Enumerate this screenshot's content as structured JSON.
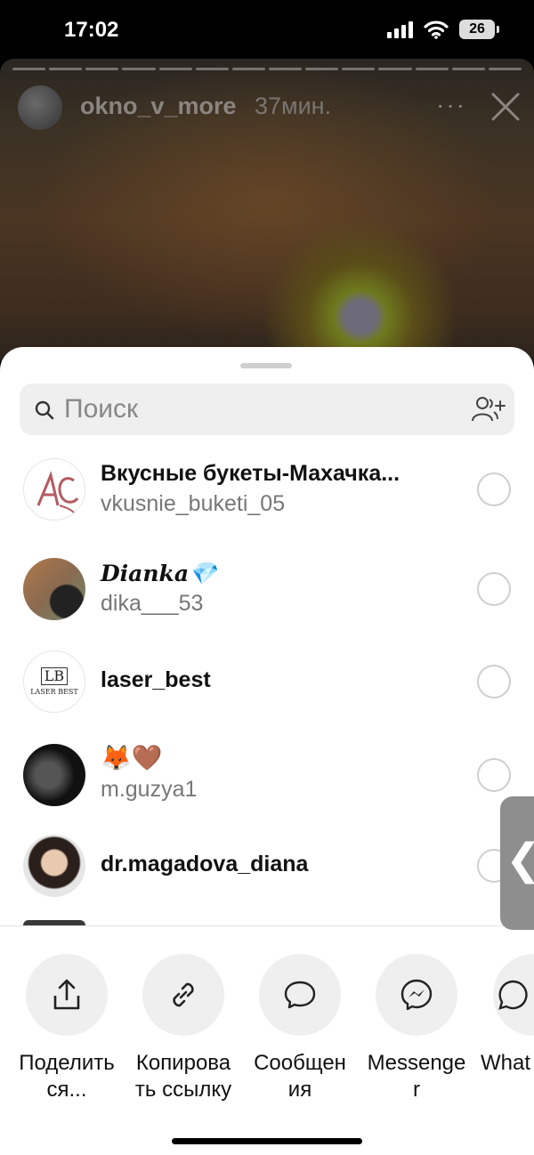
{
  "status_bar": {
    "time": "17:02",
    "battery": "26"
  },
  "story": {
    "username": "okno_v_more",
    "time_ago": "37мин.",
    "more_label": "···",
    "progress_segments": 14
  },
  "search": {
    "placeholder": "Поиск"
  },
  "contacts": [
    {
      "name": "Вкусные букеты-Махачка...",
      "username": "vkusnie_buketi_05"
    },
    {
      "name": "𝑫𝒊𝒂𝒏𝒌𝒂💎",
      "username": "dika___53"
    },
    {
      "name": "laser_best",
      "username": ""
    },
    {
      "name": "🦊🤎",
      "username": "m.guzya1"
    },
    {
      "name": "dr.magadova_diana",
      "username": ""
    }
  ],
  "avatar_text": {
    "laser": "LASER BEST",
    "laser_mark": "LB"
  },
  "share_actions": [
    {
      "label": "Поделить\nся...",
      "icon": "share-icon"
    },
    {
      "label": "Копирова\nть ссылку",
      "icon": "link-icon"
    },
    {
      "label": "Сообщен\nия",
      "icon": "message-icon"
    },
    {
      "label": "Messenge\nr",
      "icon": "messenger-icon"
    },
    {
      "label": "What",
      "icon": "whatsapp-icon"
    }
  ],
  "side_tab": {
    "glyph": "❮"
  }
}
